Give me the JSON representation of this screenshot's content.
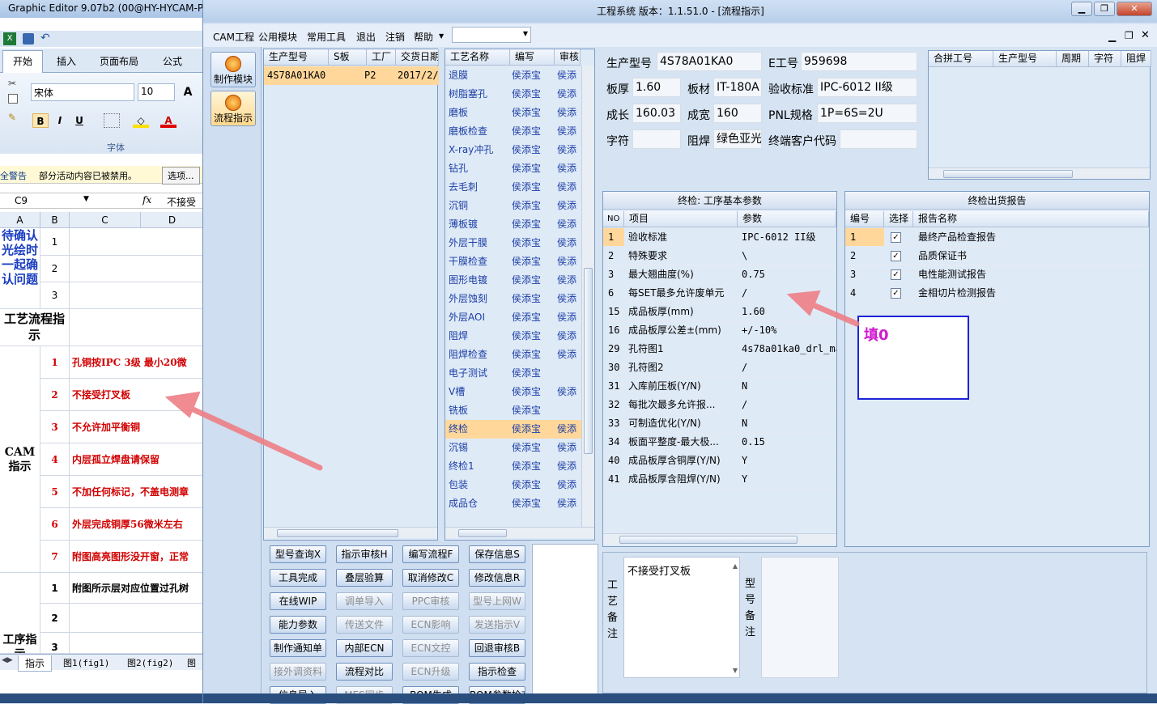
{
  "excel": {
    "title": "Graphic Editor 9.07b2 (00@HY-HYCAM-P",
    "ribbon_tabs": [
      "开始",
      "插入",
      "页面布局",
      "公式"
    ],
    "font_name": "宋体",
    "font_size": "10",
    "font_group_label": "字体",
    "security_label": "全警告",
    "security_text": "部分活动内容已被禁用。",
    "security_btn": "选项...",
    "name_box": "C9",
    "fx": "fx",
    "formula": "不接受",
    "col_headers": [
      "A",
      "B",
      "C",
      "D"
    ],
    "a_section1": "待确认光绘时一起确认问题",
    "a_section2": "工艺流程指示",
    "a_section3": "CAM指示",
    "a_section4": "工序指示",
    "b_rows1": [
      "1",
      "2",
      "3"
    ],
    "cam_rows": [
      {
        "no": "1",
        "text": "孔铜按IPC 3级 最小20微"
      },
      {
        "no": "2",
        "text": "不接受打叉板"
      },
      {
        "no": "3",
        "text": "不允许加平衡铜"
      },
      {
        "no": "4",
        "text": "内层孤立焊盘请保留"
      },
      {
        "no": "5",
        "text": "不加任何标记，不盖电测章"
      },
      {
        "no": "6",
        "text": "外层完成铜厚56微米左右"
      },
      {
        "no": "7",
        "text": "附图高亮图形没开窗，正常"
      }
    ],
    "proc_rows": [
      {
        "no": "1",
        "text": "附图所示层对应位置过孔树"
      },
      {
        "no": "2",
        "text": ""
      },
      {
        "no": "3",
        "text": ""
      }
    ],
    "sheet_tabs": [
      "指示",
      "图1(fig1)",
      "图2(fig2)",
      "图"
    ]
  },
  "main": {
    "title": "工程系统  版本：1.1.51.0 - [流程指示]",
    "menus": [
      "CAM工程",
      "公用模块",
      "常用工具",
      "退出",
      "注销",
      "帮助"
    ],
    "side_buttons": [
      "制作模块",
      "流程指示"
    ],
    "model_grid": {
      "headers": [
        "生产型号",
        "S板",
        "工厂",
        "交货日期"
      ],
      "rows": [
        {
          "model": "4S78A01KA0",
          "s": "",
          "factory": "P2",
          "date": "2017/2/"
        }
      ]
    },
    "process_grid": {
      "headers": [
        "工艺名称",
        "编写",
        "审核"
      ],
      "rows": [
        {
          "name": "退膜",
          "writer": "侯添宝",
          "reviewer": "侯添"
        },
        {
          "name": "树脂塞孔",
          "writer": "侯添宝",
          "reviewer": "侯添"
        },
        {
          "name": "磨板",
          "writer": "侯添宝",
          "reviewer": "侯添"
        },
        {
          "name": "磨板检查",
          "writer": "侯添宝",
          "reviewer": "侯添"
        },
        {
          "name": "X-ray冲孔",
          "writer": "侯添宝",
          "reviewer": "侯添"
        },
        {
          "name": "钻孔",
          "writer": "侯添宝",
          "reviewer": "侯添"
        },
        {
          "name": "去毛刺",
          "writer": "侯添宝",
          "reviewer": "侯添"
        },
        {
          "name": "沉铜",
          "writer": "侯添宝",
          "reviewer": "侯添"
        },
        {
          "name": "薄板镀",
          "writer": "侯添宝",
          "reviewer": "侯添"
        },
        {
          "name": "外层干膜",
          "writer": "侯添宝",
          "reviewer": "侯添"
        },
        {
          "name": "干膜检查",
          "writer": "侯添宝",
          "reviewer": "侯添"
        },
        {
          "name": "图形电镀",
          "writer": "侯添宝",
          "reviewer": "侯添"
        },
        {
          "name": "外层蚀刻",
          "writer": "侯添宝",
          "reviewer": "侯添"
        },
        {
          "name": "外层AOI",
          "writer": "侯添宝",
          "reviewer": "侯添"
        },
        {
          "name": "阻焊",
          "writer": "侯添宝",
          "reviewer": "侯添"
        },
        {
          "name": "阻焊检查",
          "writer": "侯添宝",
          "reviewer": "侯添"
        },
        {
          "name": "电子测试",
          "writer": "侯添宝",
          "reviewer": ""
        },
        {
          "name": "V槽",
          "writer": "侯添宝",
          "reviewer": "侯添"
        },
        {
          "name": "铣板",
          "writer": "侯添宝",
          "reviewer": ""
        },
        {
          "name": "终检",
          "writer": "侯添宝",
          "reviewer": "侯添"
        },
        {
          "name": "沉锡",
          "writer": "侯添宝",
          "reviewer": "侯添"
        },
        {
          "name": "终检1",
          "writer": "侯添宝",
          "reviewer": "侯添"
        },
        {
          "name": "包装",
          "writer": "侯添宝",
          "reviewer": "侯添"
        },
        {
          "name": "成品仓",
          "writer": "侯添宝",
          "reviewer": "侯添"
        }
      ]
    },
    "info": {
      "model_label": "生产型号",
      "model": "4S78A01KA0",
      "eno_label": "E工号",
      "eno": "959698",
      "thick_label": "板厚",
      "thick": "1.60",
      "mat_label": "板材",
      "mat": "IT-180A",
      "std_label": "验收标准",
      "std": "IPC-6012 II级",
      "len_label": "成长",
      "len": "160.03",
      "wid_label": "成宽",
      "wid": "160",
      "pnl_label": "PNL规格",
      "pnl": "1P=6S=2U",
      "char_label": "字符",
      "char": "",
      "mask_label": "阻焊",
      "mask": "绿色亚光",
      "cust_label": "终端客户代码",
      "cust": ""
    },
    "merge_grid": {
      "headers": [
        "合拼工号",
        "生产型号",
        "周期",
        "字符",
        "阻焊"
      ]
    },
    "param_panel": {
      "title": "终检: 工序基本参数",
      "headers": [
        "NO",
        "项目",
        "参数"
      ],
      "rows": [
        {
          "no": "1",
          "item": "验收标准",
          "value": "IPC-6012 II级"
        },
        {
          "no": "2",
          "item": "特殊要求",
          "value": "\\"
        },
        {
          "no": "3",
          "item": "最大翘曲度(%)",
          "value": "0.75"
        },
        {
          "no": "6",
          "item": "每SET最多允许废单元",
          "value": "/"
        },
        {
          "no": "15",
          "item": "成品板厚(mm)",
          "value": "1.60"
        },
        {
          "no": "16",
          "item": "成品板厚公差±(mm)",
          "value": "+/-10%"
        },
        {
          "no": "29",
          "item": "孔符图1",
          "value": "4s78a01ka0_drl_ma"
        },
        {
          "no": "30",
          "item": "孔符图2",
          "value": "/"
        },
        {
          "no": "31",
          "item": "入库前压板(Y/N)",
          "value": "N"
        },
        {
          "no": "32",
          "item": "每批次最多允许报...",
          "value": "/"
        },
        {
          "no": "33",
          "item": "可制造优化(Y/N)",
          "value": "N"
        },
        {
          "no": "34",
          "item": "板面平整度-最大极...",
          "value": "0.15"
        },
        {
          "no": "40",
          "item": "成品板厚含铜厚(Y/N)",
          "value": "Y"
        },
        {
          "no": "41",
          "item": "成品板厚含阻焊(Y/N)",
          "value": "Y"
        }
      ]
    },
    "report_panel": {
      "title": "终检出货报告",
      "headers": [
        "编号",
        "选择",
        "报告名称"
      ],
      "rows": [
        {
          "no": "1",
          "checked": "✓",
          "name": "最终产品检查报告"
        },
        {
          "no": "2",
          "checked": "✓",
          "name": "品质保证书"
        },
        {
          "no": "3",
          "checked": "✓",
          "name": "电性能测试报告"
        },
        {
          "no": "4",
          "checked": "✓",
          "name": "金相切片检测报告"
        }
      ]
    },
    "annotation_text": "填0",
    "remarks": {
      "craft_label": "工艺备注",
      "craft_text": "不接受打叉板",
      "model_label": "型号备注",
      "model_text": ""
    },
    "buttons": [
      {
        "label": "型号查询X",
        "enabled": true
      },
      {
        "label": "指示审核H",
        "enabled": true
      },
      {
        "label": "编写流程F",
        "enabled": true
      },
      {
        "label": "保存信息S",
        "enabled": true
      },
      {
        "label": "工具完成",
        "enabled": true
      },
      {
        "label": "叠层验算",
        "enabled": true
      },
      {
        "label": "取消修改C",
        "enabled": true
      },
      {
        "label": "修改信息R",
        "enabled": true
      },
      {
        "label": "在线WIP",
        "enabled": true
      },
      {
        "label": "调单导入",
        "enabled": false
      },
      {
        "label": "PPC审核",
        "enabled": false
      },
      {
        "label": "型号上网W",
        "enabled": false
      },
      {
        "label": "能力参数",
        "enabled": true
      },
      {
        "label": "传送文件",
        "enabled": false
      },
      {
        "label": "ECN影响",
        "enabled": false
      },
      {
        "label": "发送指示V",
        "enabled": false
      },
      {
        "label": "制作通知单",
        "enabled": true
      },
      {
        "label": "内部ECN",
        "enabled": true
      },
      {
        "label": "ECN文控",
        "enabled": false
      },
      {
        "label": "回退审核B",
        "enabled": true
      },
      {
        "label": "接外调资料",
        "enabled": false
      },
      {
        "label": "流程对比",
        "enabled": true
      },
      {
        "label": "ECN升级",
        "enabled": false
      },
      {
        "label": "指示检查",
        "enabled": true
      },
      {
        "label": "信息导入",
        "enabled": true
      },
      {
        "label": "MES同步",
        "enabled": false
      },
      {
        "label": "BOM生成",
        "enabled": true
      },
      {
        "label": "BOM参数检查",
        "enabled": true
      }
    ]
  }
}
